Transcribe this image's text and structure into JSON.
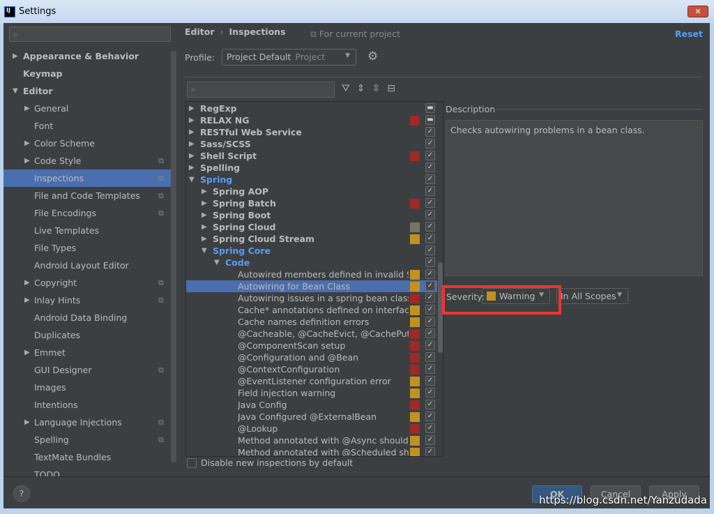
{
  "window": {
    "title": "Settings",
    "close_label": "✕"
  },
  "sidebar": {
    "items": [
      {
        "label": "Appearance & Behavior",
        "level": 0,
        "arrow": "right",
        "bold": true
      },
      {
        "label": "Keymap",
        "level": 0,
        "arrow": "",
        "bold": true
      },
      {
        "label": "Editor",
        "level": 0,
        "arrow": "down",
        "bold": true
      },
      {
        "label": "General",
        "level": 1,
        "arrow": "right"
      },
      {
        "label": "Font",
        "level": 1,
        "arrow": ""
      },
      {
        "label": "Color Scheme",
        "level": 1,
        "arrow": "right"
      },
      {
        "label": "Code Style",
        "level": 1,
        "arrow": "right",
        "copy": true
      },
      {
        "label": "Inspections",
        "level": 1,
        "arrow": "",
        "copy": true,
        "selected": true
      },
      {
        "label": "File and Code Templates",
        "level": 1,
        "arrow": "",
        "copy": true
      },
      {
        "label": "File Encodings",
        "level": 1,
        "arrow": "",
        "copy": true
      },
      {
        "label": "Live Templates",
        "level": 1,
        "arrow": ""
      },
      {
        "label": "File Types",
        "level": 1,
        "arrow": ""
      },
      {
        "label": "Android Layout Editor",
        "level": 1,
        "arrow": ""
      },
      {
        "label": "Copyright",
        "level": 1,
        "arrow": "right",
        "copy": true
      },
      {
        "label": "Inlay Hints",
        "level": 1,
        "arrow": "right",
        "copy": true
      },
      {
        "label": "Android Data Binding",
        "level": 1,
        "arrow": ""
      },
      {
        "label": "Duplicates",
        "level": 1,
        "arrow": ""
      },
      {
        "label": "Emmet",
        "level": 1,
        "arrow": "right"
      },
      {
        "label": "GUI Designer",
        "level": 1,
        "arrow": "",
        "copy": true
      },
      {
        "label": "Images",
        "level": 1,
        "arrow": ""
      },
      {
        "label": "Intentions",
        "level": 1,
        "arrow": ""
      },
      {
        "label": "Language Injections",
        "level": 1,
        "arrow": "right",
        "copy": true
      },
      {
        "label": "Spelling",
        "level": 1,
        "arrow": "",
        "copy": true
      },
      {
        "label": "TextMate Bundles",
        "level": 1,
        "arrow": ""
      },
      {
        "label": "TODO",
        "level": 1,
        "arrow": ""
      }
    ]
  },
  "header": {
    "breadcrumb": [
      "Editor",
      "Inspections"
    ],
    "breadcrumb_sep": "›",
    "for_project": "For current project",
    "reset": "Reset"
  },
  "profile": {
    "label": "Profile:",
    "value": "Project Default",
    "scope": "Project"
  },
  "colors": {
    "error": "#9e2927",
    "warning": "#c29220",
    "weak": "#7a7562",
    "accent": "#589df6",
    "selection": "#4b6eaf"
  },
  "tree": [
    {
      "label": "RegExp",
      "level": 0,
      "arrow": "right",
      "check": "mixed"
    },
    {
      "label": "RELAX NG",
      "level": 0,
      "arrow": "right",
      "sev": "error",
      "check": "mixed"
    },
    {
      "label": "RESTful Web Service",
      "level": 0,
      "arrow": "right",
      "check": "on"
    },
    {
      "label": "Sass/SCSS",
      "level": 0,
      "arrow": "right",
      "check": "on"
    },
    {
      "label": "Shell Script",
      "level": 0,
      "arrow": "right",
      "sev": "error",
      "check": "on"
    },
    {
      "label": "Spelling",
      "level": 0,
      "arrow": "right",
      "check": "on"
    },
    {
      "label": "Spring",
      "level": 0,
      "arrow": "down",
      "check": "on",
      "blue": true
    },
    {
      "label": "Spring AOP",
      "level": 1,
      "arrow": "right",
      "check": "on"
    },
    {
      "label": "Spring Batch",
      "level": 1,
      "arrow": "right",
      "sev": "error",
      "check": "on"
    },
    {
      "label": "Spring Boot",
      "level": 1,
      "arrow": "right",
      "check": "on"
    },
    {
      "label": "Spring Cloud",
      "level": 1,
      "arrow": "right",
      "sev": "weak",
      "check": "on"
    },
    {
      "label": "Spring Cloud Stream",
      "level": 1,
      "arrow": "right",
      "sev": "warning",
      "check": "on"
    },
    {
      "label": "Spring Core",
      "level": 1,
      "arrow": "down",
      "check": "on",
      "blue": true
    },
    {
      "label": "Code",
      "level": 2,
      "arrow": "down",
      "check": "on",
      "blue": true
    },
    {
      "label": "Autowired members defined in invalid Spring",
      "level": 3,
      "sev": "warning",
      "check": "on"
    },
    {
      "label": "Autowiring for Bean Class",
      "level": 3,
      "sev": "warning",
      "check": "on",
      "selected": true
    },
    {
      "label": "Autowiring issues in a spring bean class c",
      "level": 3,
      "sev": "error",
      "check": "on"
    },
    {
      "label": "Cache* annotations defined on interfaces/",
      "level": 3,
      "sev": "warning",
      "check": "on"
    },
    {
      "label": "Cache names definition errors",
      "level": 3,
      "sev": "warning",
      "check": "on"
    },
    {
      "label": "@Cacheable, @CacheEvict, @CachePut, @",
      "level": 3,
      "sev": "error",
      "check": "on"
    },
    {
      "label": "@ComponentScan setup",
      "level": 3,
      "sev": "error",
      "check": "on"
    },
    {
      "label": "@Configuration and @Bean",
      "level": 3,
      "sev": "error",
      "check": "on"
    },
    {
      "label": "@ContextConfiguration",
      "level": 3,
      "sev": "error",
      "check": "on"
    },
    {
      "label": "@EventListener configuration error",
      "level": 3,
      "sev": "warning",
      "check": "on"
    },
    {
      "label": "Field injection warning",
      "level": 3,
      "sev": "warning",
      "check": "on"
    },
    {
      "label": "Java Config",
      "level": 3,
      "sev": "error",
      "check": "on"
    },
    {
      "label": "Java Configured @ExternalBean",
      "level": 3,
      "sev": "warning",
      "check": "on"
    },
    {
      "label": "@Lookup",
      "level": 3,
      "sev": "error",
      "check": "on"
    },
    {
      "label": "Method annotated with @Async should re",
      "level": 3,
      "sev": "warning",
      "check": "on"
    },
    {
      "label": "Method annotated with @Scheduled shou",
      "level": 3,
      "sev": "warning",
      "check": "on"
    }
  ],
  "description": {
    "label": "Description",
    "text": "Checks autowiring problems in a bean class."
  },
  "severity": {
    "label": "Severity:",
    "value": "Warning",
    "scope": "In All Scopes"
  },
  "disable_new": {
    "label": "Disable new inspections by default",
    "checked": false
  },
  "buttons": {
    "help": "?",
    "ok": "OK",
    "cancel": "Cancel",
    "apply": "Apply"
  },
  "watermark": "https://blog.csdn.net/Yanzudada"
}
